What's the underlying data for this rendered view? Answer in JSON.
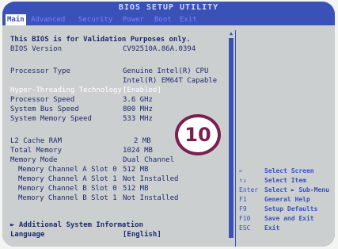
{
  "window": {
    "title": "BIOS SETUP UTILITY"
  },
  "menu": [
    {
      "label": "Main",
      "active": true
    },
    {
      "label": "Advanced",
      "active": false
    },
    {
      "label": "Security",
      "active": false
    },
    {
      "label": "Power",
      "active": false
    },
    {
      "label": "Boot",
      "active": false
    },
    {
      "label": "Exit",
      "active": false
    }
  ],
  "main": {
    "notice": "This BIOS is for Validation Purposes only.",
    "rows": [
      {
        "label": "BIOS Version",
        "value": "CV92510A.86A.0394"
      },
      {
        "label": "Processor Type",
        "value": "Genuine Intel(R) CPU"
      },
      {
        "label": "",
        "value": "Intel(R) EM64T Capable"
      },
      {
        "label": "Hyper-Threading Technology",
        "value": "[Enabled]"
      },
      {
        "label": "Processor Speed",
        "value": "3.6 GHz"
      },
      {
        "label": "System Bus Speed",
        "value": "800 MHz"
      },
      {
        "label": "System Memory Speed",
        "value": "533 MHz"
      },
      {
        "label": "L2 Cache RAM",
        "value": "2 MB"
      },
      {
        "label": "Total Memory",
        "value": "1024 MB"
      },
      {
        "label": "Memory Mode",
        "value": "Dual Channel"
      },
      {
        "label": "Memory Channel A Slot 0",
        "value": "512 MB"
      },
      {
        "label": "Memory Channel A Slot 1",
        "value": "Not Installed"
      },
      {
        "label": "Memory Channel B Slot 0",
        "value": "512 MB"
      },
      {
        "label": "Memory Channel B Slot 1",
        "value": "Not Installed"
      }
    ],
    "additional_info": "► Additional System Information",
    "language_label": "Language",
    "language_value": "[English]"
  },
  "help": {
    "keys": [
      {
        "key": "←",
        "desc": "Select Screen"
      },
      {
        "key": "↑↓",
        "desc": "Select Item"
      },
      {
        "key": "Enter",
        "desc": "Select ► Sub-Menu"
      },
      {
        "key": "F1",
        "desc": "General Help"
      },
      {
        "key": "F9",
        "desc": "Setup Defaults"
      },
      {
        "key": "F10",
        "desc": "Save and Exit"
      },
      {
        "key": "ESC",
        "desc": "Exit"
      }
    ]
  },
  "badge": {
    "label": "10"
  },
  "colors": {
    "menu_bar": "#3a52b8",
    "screen_bg": "#cccfd0",
    "text": "#1d2a6a",
    "highlight_text": "#ffffff",
    "badge_ring": "#7a1f4e"
  },
  "icons": {
    "scroll_up": "triangle-up-icon"
  }
}
